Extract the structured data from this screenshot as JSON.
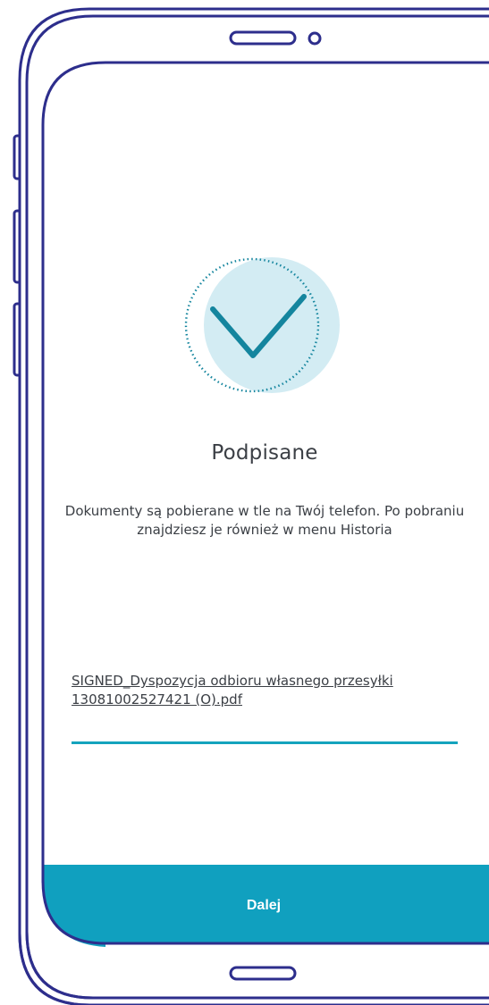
{
  "screen": {
    "title": "Podpisane",
    "message": "Dokumenty są pobierane w tle na Twój telefon. Po pobraniu znajdziesz je również w menu Historia",
    "file_link": "SIGNED_Dyspozycja odbioru własnego przesyłki 13081002527421 (O).pdf",
    "download_progress": 1.0,
    "next_label": "Dalej"
  },
  "icons": {
    "status": "checkmark-icon"
  },
  "colors": {
    "accent": "#10a0bf",
    "check_stroke": "#14859e",
    "circle_fill": "#d3ecf3",
    "phone_outline": "#2d2e8c"
  }
}
